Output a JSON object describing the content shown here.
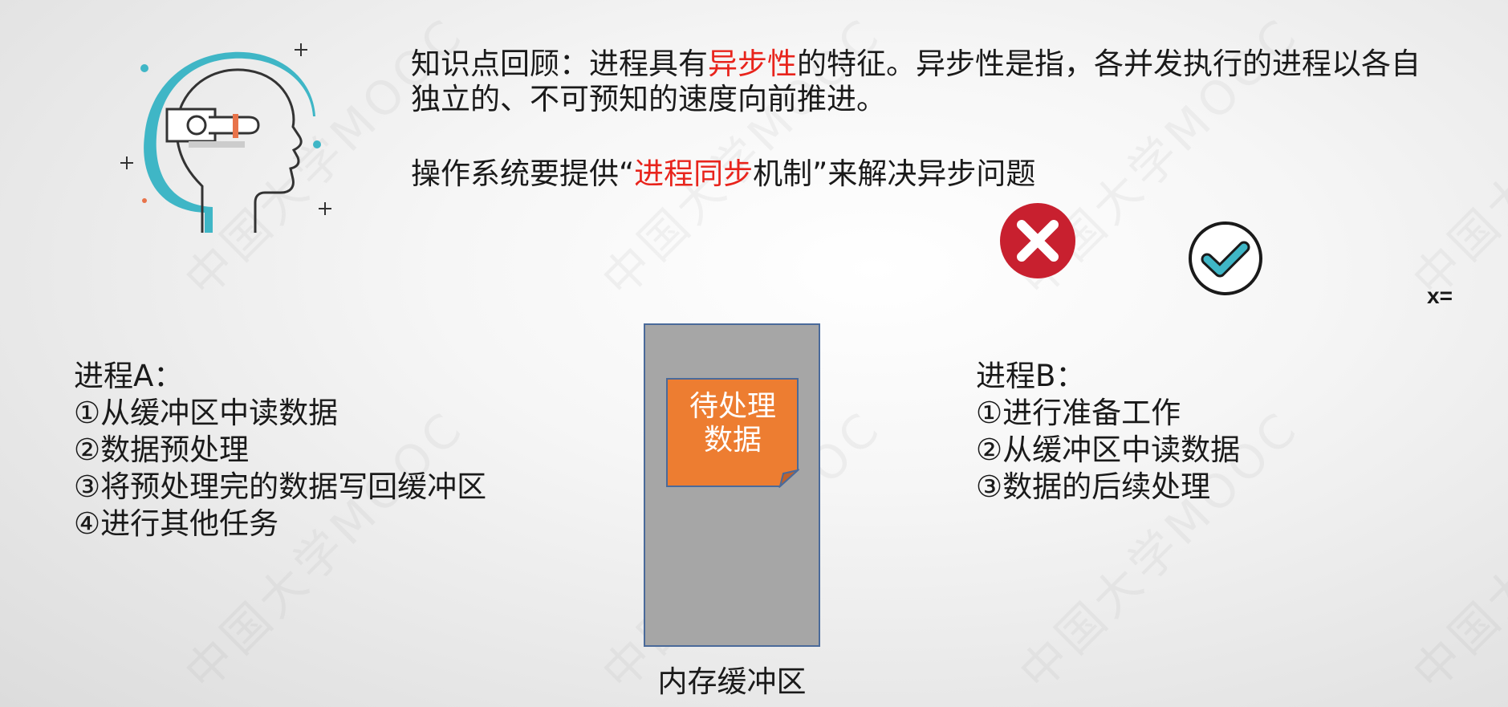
{
  "watermark": {
    "text": "中国大学MOOC"
  },
  "recap": {
    "prefix": "知识点回顾：进程具有",
    "highlight": "异步性",
    "suffix": "的特征。异步性是指，各并发执行的进程以各自独立的、不可预知的速度向前推进。"
  },
  "sync": {
    "prefix": "操作系统要提供“",
    "highlight": "进程同步",
    "suffix": "机制”来解决异步问题"
  },
  "icons": {
    "brain": "head-with-watch-icon",
    "wrong": "x-circle-icon",
    "right": "check-circle-icon"
  },
  "variable_label": "x=",
  "process_a": {
    "title": "进程A：",
    "steps": [
      "①从缓冲区中读数据",
      "②数据预处理",
      "③将预处理完的数据写回缓冲区",
      "④进行其他任务"
    ]
  },
  "process_b": {
    "title": "进程B：",
    "steps": [
      "①进行准备工作",
      "②从缓冲区中读数据",
      "③数据的后续处理"
    ]
  },
  "buffer": {
    "note_line1": "待处理",
    "note_line2": "数据",
    "caption": "内存缓冲区"
  },
  "colors": {
    "highlight": "#e8241c",
    "note": "#ed7d31",
    "buffer": "#a6a6a6",
    "teal": "#3fb6c6",
    "wrong": "#c8202f"
  }
}
